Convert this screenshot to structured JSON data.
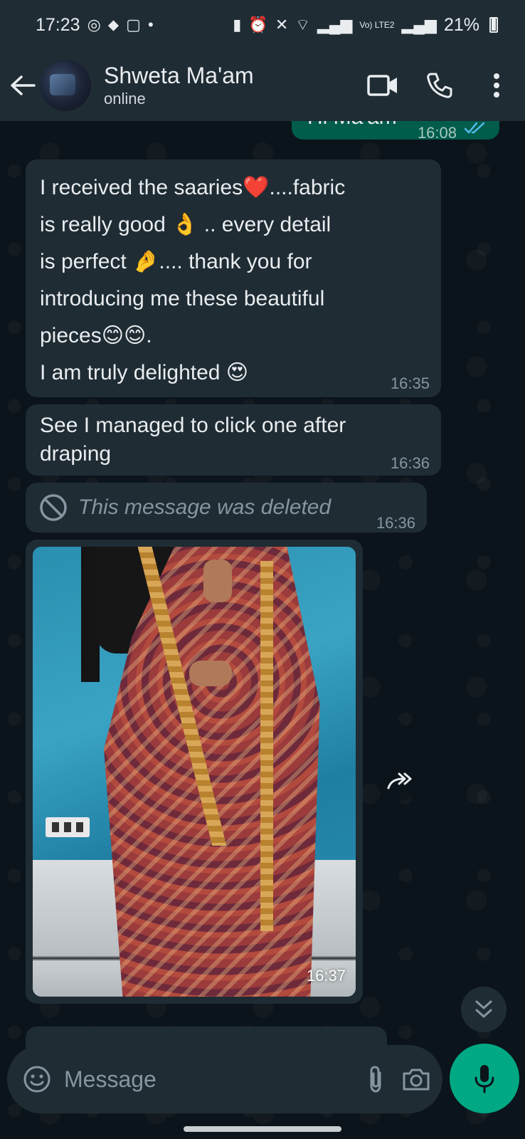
{
  "status_bar": {
    "time": "17:23",
    "network": "Vo) LTE2",
    "battery": "21%"
  },
  "header": {
    "contact_name": "Shweta Ma'am",
    "contact_status": "online"
  },
  "messages": [
    {
      "direction": "out",
      "text": "Hi Ma'am",
      "time": "16:08",
      "read": true
    },
    {
      "direction": "in",
      "text": "I received the saaries❤️....fabric\nis really good 👌 .. every detail\nis perfect 🤌.... thank you for\nintroducing me these beautiful\npieces😊😊.\nI am truly delighted 😍",
      "time": "16:35"
    },
    {
      "direction": "in",
      "text": "See I managed to click one after\ndraping",
      "time": "16:36"
    },
    {
      "direction": "in",
      "deleted": true,
      "text": "This message was deleted",
      "time": "16:36"
    },
    {
      "direction": "in",
      "type": "image",
      "time": "16:37"
    }
  ],
  "input": {
    "placeholder": "Message"
  },
  "colors": {
    "header_bg": "#1f2c34",
    "chat_bg": "#0b141a",
    "incoming_bubble": "#1f2c34",
    "outgoing_bubble": "#005c4b",
    "accent": "#00a884",
    "read_ticks": "#53bdeb"
  },
  "icons": [
    "back-arrow-icon",
    "video-call-icon",
    "phone-icon",
    "more-options-icon",
    "forward-icon",
    "scroll-down-icon",
    "emoji-icon",
    "attach-icon",
    "camera-icon",
    "mic-icon",
    "deleted-icon",
    "double-tick-icon"
  ]
}
